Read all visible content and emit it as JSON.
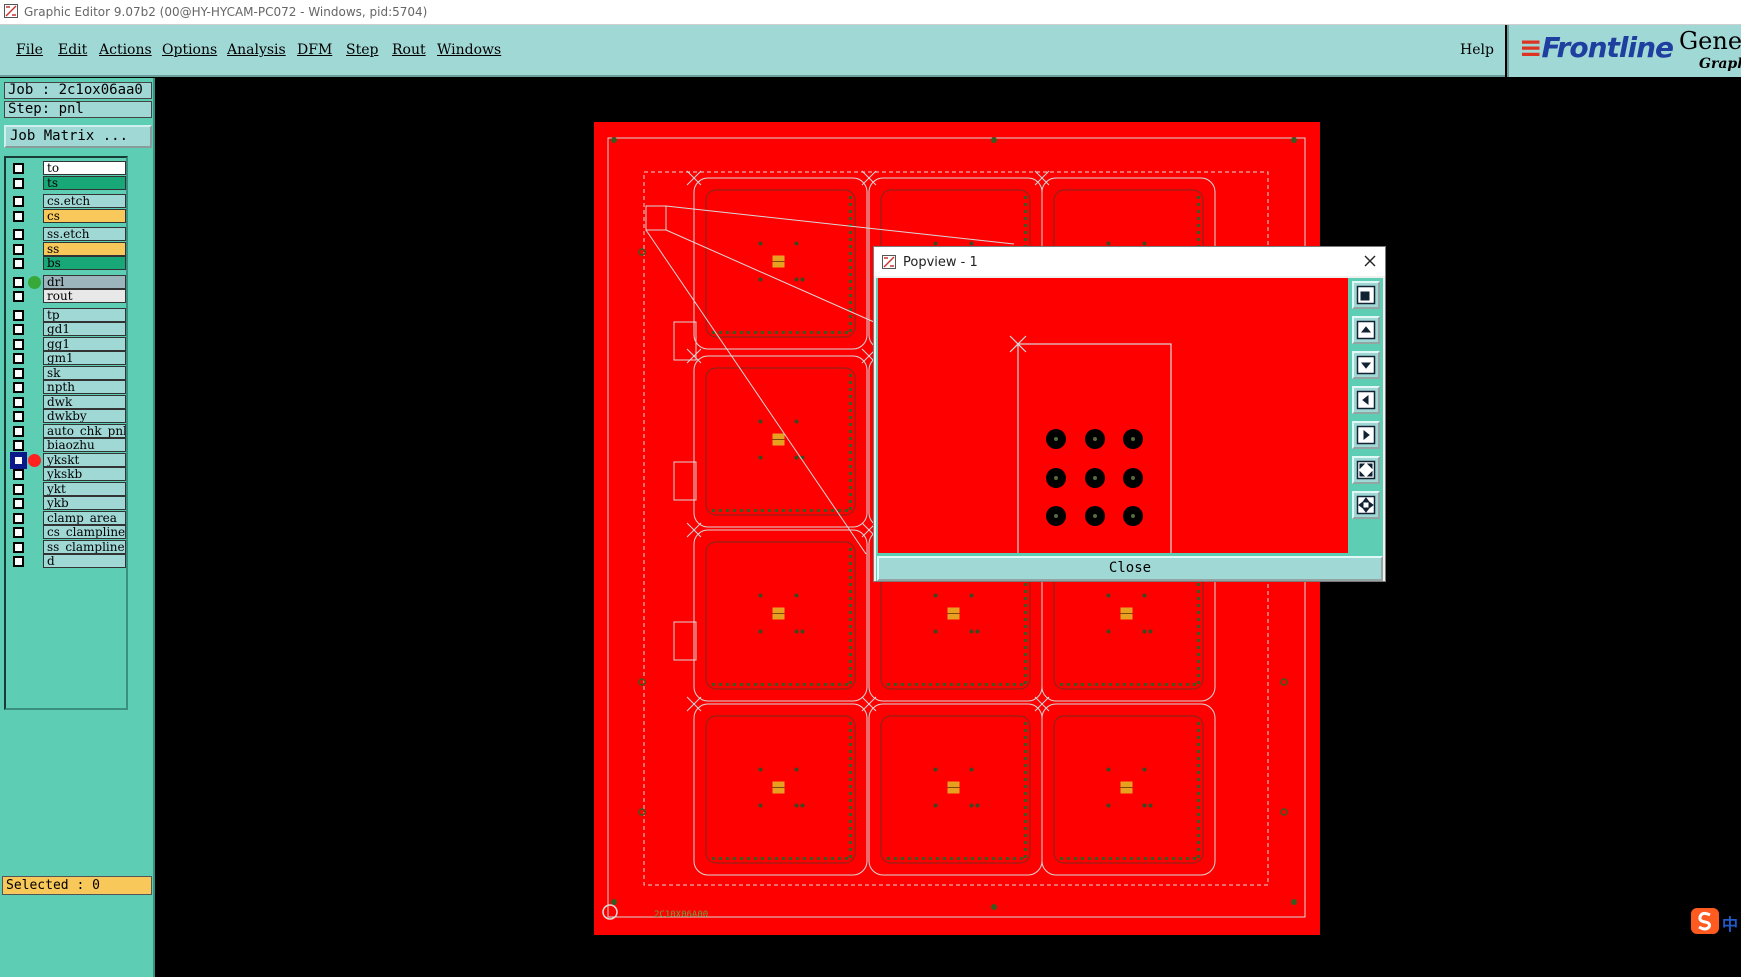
{
  "window": {
    "title": "Graphic Editor 9.07b2 (00@HY-HYCAM-PC072 - Windows, pid:5704)",
    "icon": "app-icon"
  },
  "menubar": {
    "items": [
      {
        "label": "File"
      },
      {
        "label": "Edit"
      },
      {
        "label": "Actions"
      },
      {
        "label": "Options"
      },
      {
        "label": "Analysis"
      },
      {
        "label": "DFM"
      },
      {
        "label": "Step"
      },
      {
        "label": "Rout"
      },
      {
        "label": "Windows"
      }
    ],
    "help": "Help"
  },
  "brand": {
    "logo": "Frontline",
    "product": "Genes",
    "subtitle": "Graphi"
  },
  "job": {
    "job_line": "Job : 2c1ox06aa0",
    "step_line": "Step: pnl",
    "matrix_button": "Job Matrix ..."
  },
  "layers": [
    {
      "name": "to",
      "color": "#ffffff",
      "dot": ""
    },
    {
      "name": "ts",
      "color": "#18a878",
      "dot": ""
    },
    {
      "name": "cs.etch",
      "color": "#a0d8d6",
      "dot": ""
    },
    {
      "name": "cs",
      "color": "#f8c85a",
      "dot": ""
    },
    {
      "name": "ss.etch",
      "color": "#a0d8d6",
      "dot": ""
    },
    {
      "name": "ss",
      "color": "#f8c85a",
      "dot": ""
    },
    {
      "name": "bs",
      "color": "#18a878",
      "dot": ""
    },
    {
      "name": "drl",
      "color": "#9cb4bc",
      "dot": "#38a838"
    },
    {
      "name": "rout",
      "color": "#e8e8e8",
      "dot": ""
    },
    {
      "name": "tp",
      "color": "#a0d8d6",
      "dot": ""
    },
    {
      "name": "gd1",
      "color": "#a0d8d6",
      "dot": ""
    },
    {
      "name": "gg1",
      "color": "#a0d8d6",
      "dot": ""
    },
    {
      "name": "gm1",
      "color": "#a0d8d6",
      "dot": ""
    },
    {
      "name": "sk",
      "color": "#a0d8d6",
      "dot": ""
    },
    {
      "name": "npth",
      "color": "#a0d8d6",
      "dot": ""
    },
    {
      "name": "dwk",
      "color": "#a0d8d6",
      "dot": ""
    },
    {
      "name": "dwkby",
      "color": "#a0d8d6",
      "dot": ""
    },
    {
      "name": "auto_chk_pnl",
      "color": "#a0d8d6",
      "dot": ""
    },
    {
      "name": "biaozhu",
      "color": "#a0d8d6",
      "dot": ""
    },
    {
      "name": "ykskt",
      "color": "#a0d8d6",
      "dot": "#ff2020",
      "active": true
    },
    {
      "name": "ykskb",
      "color": "#a0d8d6",
      "dot": ""
    },
    {
      "name": "ykt",
      "color": "#a0d8d6",
      "dot": ""
    },
    {
      "name": "ykb",
      "color": "#a0d8d6",
      "dot": ""
    },
    {
      "name": "clamp_area",
      "color": "#a0d8d6",
      "dot": ""
    },
    {
      "name": "cs_clampline",
      "color": "#a0d8d6",
      "dot": ""
    },
    {
      "name": "ss_clampline",
      "color": "#a0d8d6",
      "dot": ""
    },
    {
      "name": "d",
      "color": "#a0d8d6",
      "dot": ""
    }
  ],
  "status": {
    "selected": "Selected : 0"
  },
  "board": {
    "panel_label": "2C10X06A00",
    "panel_color": "#ff0000",
    "pad_color": "#e8a020",
    "outline_color": "#d8d8d8"
  },
  "popview": {
    "title": "Popview - 1",
    "close_label": "Close",
    "tools": [
      "zoom-window-icon",
      "pan-up-icon",
      "pan-down-icon",
      "pan-left-icon",
      "pan-right-icon",
      "zoom-fit-icon",
      "zoom-center-icon"
    ]
  },
  "ime": {
    "label": "中"
  }
}
